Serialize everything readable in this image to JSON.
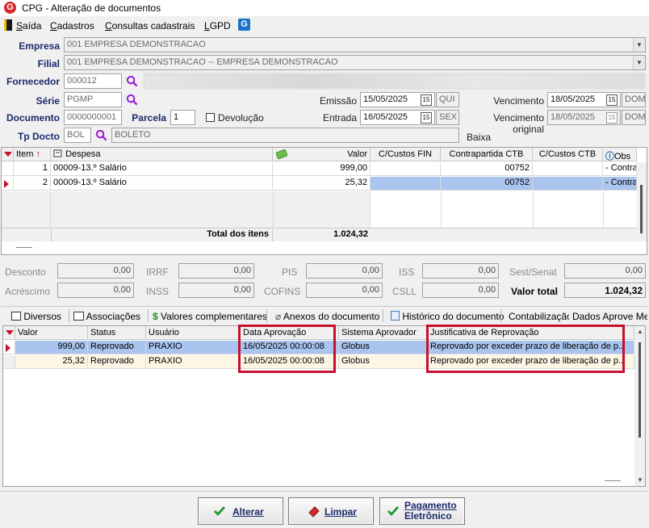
{
  "window": {
    "title": "CPG - Alteração de documentos",
    "logo_letter": "G"
  },
  "menu": {
    "items": [
      "Saída",
      "Cadastros",
      "Consultas cadastrais",
      "LGPD"
    ]
  },
  "form": {
    "empresa_label": "Empresa",
    "empresa_value": "001 EMPRESA DEMONSTRACAO",
    "filial_label": "Filial",
    "filial_value": "001 EMPRESA DEMONSTRACAO -- EMPRESA DEMONSTRACAO",
    "fornecedor_label": "Fornecedor",
    "fornecedor_value": "000012",
    "serie_label": "Série",
    "serie_value": "PGMP",
    "documento_label": "Documento",
    "documento_value": "0000000001",
    "parcela_label": "Parcela",
    "parcela_value": "1",
    "devolucao_label": "Devolução",
    "tpdocto_label": "Tp Docto",
    "tpdocto_value": "BOL",
    "tpdocto_desc": "BOLETO",
    "emissao_label": "Emissão",
    "emissao_value": "15/05/2025",
    "emissao_day": "QUI",
    "entrada_label": "Entrada",
    "entrada_value": "16/05/2025",
    "entrada_day": "SEX",
    "vencimento_label": "Vencimento",
    "vencimento_value": "18/05/2025",
    "vencimento_day": "DOM",
    "venc_original_label": "Vencimento original",
    "venc_original_value": "18/05/2025",
    "venc_original_day": "DOM",
    "baixa_label": "Baixa",
    "cal_glyph": "15"
  },
  "items_grid": {
    "headers": {
      "item": "Item",
      "despesa": "Despesa",
      "valor": "Valor",
      "ccfin": "C/Custos FIN",
      "contrapartida": "Contrapartida CTB",
      "ccctb": "C/Custos CTB",
      "obs": "Obs"
    },
    "rows": [
      {
        "item": "1",
        "despesa": "00009-13.º Salário",
        "valor": "999,00",
        "contrapartida": "00752",
        "obs": "- Contra"
      },
      {
        "item": "2",
        "despesa": "00009-13.º Salário",
        "valor": "25,32",
        "contrapartida": "00752",
        "obs": "- Contra"
      }
    ],
    "total_label": "Total dos itens",
    "total_value": "1.024,32"
  },
  "totals": {
    "desconto_label": "Desconto",
    "desconto": "0,00",
    "acrescimo_label": "Acréscimo",
    "acrescimo": "0,00",
    "irrf_label": "IRRF",
    "irrf": "0,00",
    "inss_label": "INSS",
    "inss": "0,00",
    "pis_label": "PIS",
    "pis": "0,00",
    "cofins_label": "COFINS",
    "cofins": "0,00",
    "iss_label": "ISS",
    "iss": "0,00",
    "csll_label": "CSLL",
    "csll": "0,00",
    "sest_label": "Sest/Senat",
    "sest": "0,00",
    "valor_total_label": "Valor total",
    "valor_total": "1.024,32"
  },
  "tabs": [
    "Diversos",
    "Associações",
    "Valores complementares",
    "Anexos do documento",
    "Histórico do documento",
    "Contabilização",
    "Dados Aprove Me"
  ],
  "approval_grid": {
    "headers": {
      "valor": "Valor",
      "status": "Status",
      "usuario": "Usuário",
      "data": "Data Aprovação",
      "sistema": "Sistema Aprovador",
      "justificativa": "Justificativa de Reprovação"
    },
    "rows": [
      {
        "valor": "999,00",
        "status": "Reprovado",
        "usuario": "PRAXIO",
        "data": "16/05/2025 00:00:08",
        "sistema": "Globus",
        "justificativa": "Reprovado por exceder prazo de liberação de p..."
      },
      {
        "valor": "25,32",
        "status": "Reprovado",
        "usuario": "PRAXIO",
        "data": "16/05/2025 00:00:08",
        "sistema": "Globus",
        "justificativa": "Reprovado por exceder prazo de liberação de p..."
      }
    ]
  },
  "buttons": {
    "alterar": "Alterar",
    "limpar": "Limpar",
    "pagamento_1": "Pagamento",
    "pagamento_2": "Eletrônico"
  }
}
